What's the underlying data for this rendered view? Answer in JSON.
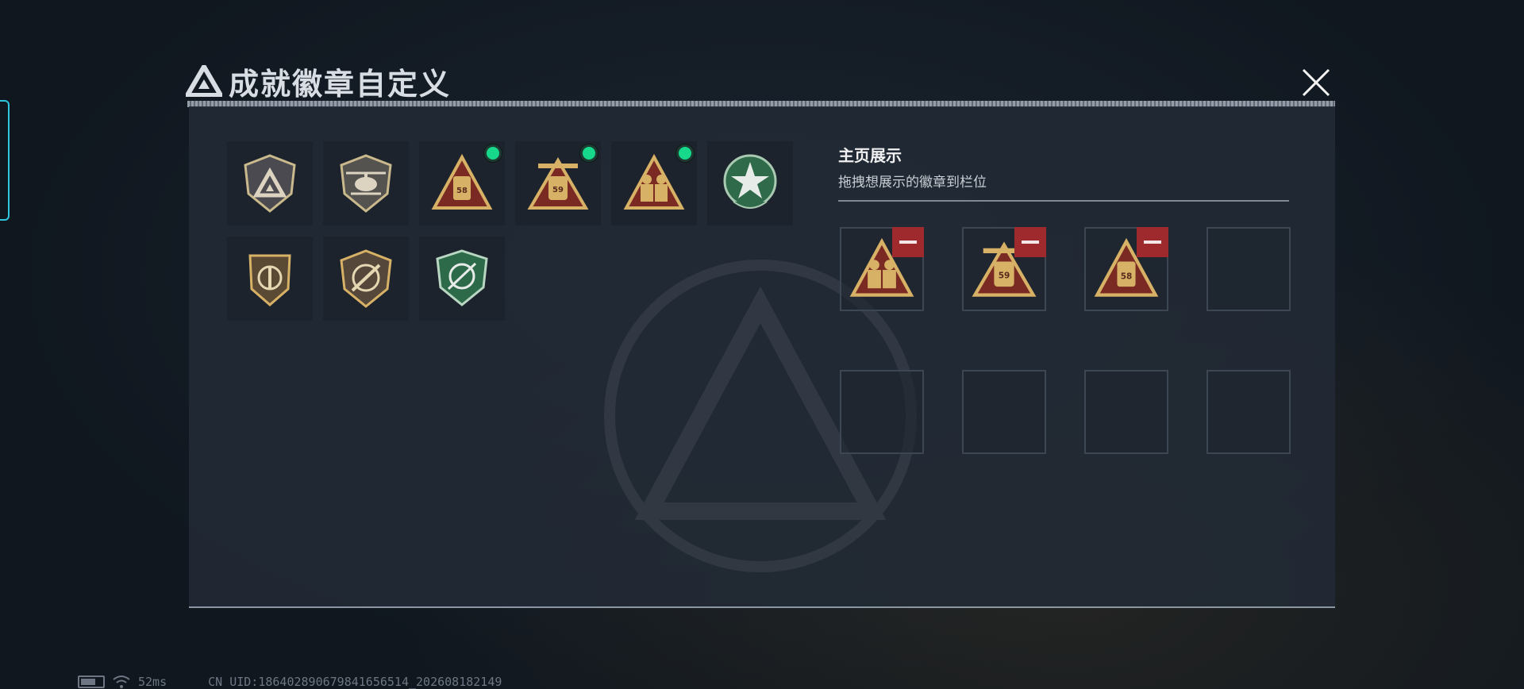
{
  "header": {
    "tiny_caption": "—",
    "title": "成就徽章自定义",
    "close_label": "关闭"
  },
  "badges": [
    {
      "name": "triangle-emblem-badge",
      "selected": false
    },
    {
      "name": "helicopter-badge",
      "selected": false
    },
    {
      "name": "vehicle-58-badge",
      "selected": true
    },
    {
      "name": "vehicle-59-badge",
      "selected": true
    },
    {
      "name": "soldiers-badge",
      "selected": true
    },
    {
      "name": "green-star-badge",
      "selected": false
    },
    {
      "name": "wing-shield-badge",
      "selected": false
    },
    {
      "name": "rifle-shield-badge",
      "selected": false
    },
    {
      "name": "green-crosshair-badge",
      "selected": false
    }
  ],
  "display": {
    "title": "主页展示",
    "subtitle": "拖拽想展示的徽章到栏位",
    "slots": [
      {
        "badge": "soldiers-badge"
      },
      {
        "badge": "vehicle-59-badge"
      },
      {
        "badge": "vehicle-58-badge"
      },
      {
        "badge": null
      },
      {
        "badge": null
      },
      {
        "badge": null
      },
      {
        "badge": null
      },
      {
        "badge": null
      }
    ]
  },
  "status": {
    "ping": "52ms",
    "uid": "CN UID:18640289067984165651​4_202608182149"
  },
  "colors": {
    "accent_green": "#17d98c",
    "remove_red": "#9e2a2e",
    "gold": "#c9a45c"
  }
}
